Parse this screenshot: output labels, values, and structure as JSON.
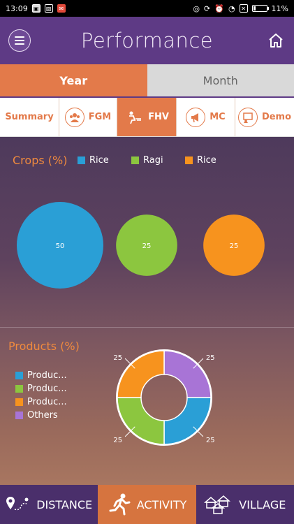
{
  "status_bar": {
    "time": "13:09",
    "battery": "11%"
  },
  "header": {
    "title": "Performance"
  },
  "period_toggle": {
    "active": "Year",
    "inactive": "Month"
  },
  "tabs": [
    {
      "label": "Summary",
      "icon": "none",
      "active": false
    },
    {
      "label": "FGM",
      "icon": "group-icon",
      "active": false
    },
    {
      "label": "FHV",
      "icon": "farmer-icon",
      "active": true
    },
    {
      "label": "MC",
      "icon": "megaphone-icon",
      "active": false
    },
    {
      "label": "Demo",
      "icon": "demo-icon",
      "active": false
    }
  ],
  "crops": {
    "title": "Crops (%)",
    "legend": [
      {
        "name": "Rice",
        "color": "#2a9fd6"
      },
      {
        "name": "Ragi",
        "color": "#8cc63f"
      },
      {
        "name": "Rice",
        "color": "#f7931e"
      }
    ]
  },
  "products": {
    "title": "Products (%)",
    "legend": [
      {
        "name": "Produc...",
        "color": "#2a9fd6"
      },
      {
        "name": "Produc...",
        "color": "#8cc63f"
      },
      {
        "name": "Produc...",
        "color": "#f7931e"
      },
      {
        "name": "Others",
        "color": "#a874d6"
      }
    ]
  },
  "chart_data": [
    {
      "type": "bubble",
      "title": "Crops (%)",
      "series": [
        {
          "name": "Rice",
          "value": 50,
          "color": "#2a9fd6"
        },
        {
          "name": "Ragi",
          "value": 25,
          "color": "#8cc63f"
        },
        {
          "name": "Rice",
          "value": 25,
          "color": "#f7931e"
        }
      ]
    },
    {
      "type": "pie",
      "title": "Products (%)",
      "donut": true,
      "slices": [
        {
          "name": "Produc...",
          "value": 25,
          "color": "#2a9fd6"
        },
        {
          "name": "Produc...",
          "value": 25,
          "color": "#8cc63f"
        },
        {
          "name": "Produc...",
          "value": 25,
          "color": "#f7931e"
        },
        {
          "name": "Others",
          "value": 25,
          "color": "#a874d6"
        }
      ]
    }
  ],
  "bottom_nav": [
    {
      "label": "DISTANCE",
      "icon": "map-pin-icon",
      "active": false
    },
    {
      "label": "ACTIVITY",
      "icon": "runner-icon",
      "active": true
    },
    {
      "label": "VILLAGE",
      "icon": "village-icon",
      "active": false
    }
  ]
}
